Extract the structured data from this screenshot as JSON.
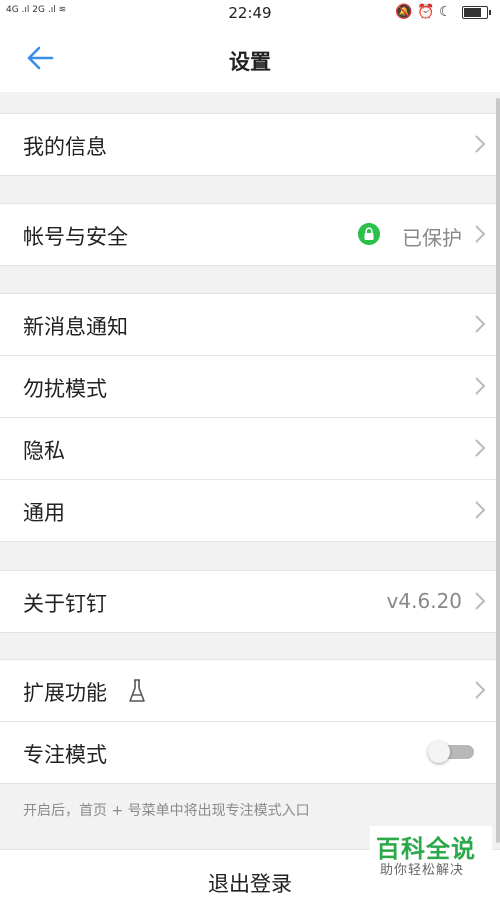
{
  "status_bar": {
    "signal": "4G .ıl 2G .ıl ≋",
    "time": "22:49",
    "right_icons": "🔕 ⏰ ☾"
  },
  "header": {
    "title": "设置"
  },
  "groups": {
    "profile": {
      "label": "我的信息"
    },
    "account": {
      "label": "帐号与安全",
      "status": "已保护"
    },
    "notifications": {
      "label": "新消息通知"
    },
    "dnd": {
      "label": "勿扰模式"
    },
    "privacy": {
      "label": "隐私"
    },
    "general": {
      "label": "通用"
    },
    "about": {
      "label": "关于钉钉",
      "version": "v4.6.20"
    },
    "extensions": {
      "label": "扩展功能"
    },
    "focus": {
      "label": "专注模式",
      "enabled": false
    }
  },
  "focus_hint": "开启后，首页 + 号菜单中将出现专注模式入口",
  "logout_label": "退出登录",
  "watermark": {
    "title": "百科全说",
    "subtitle": "助你轻松解决"
  },
  "colors": {
    "accent_blue": "#3b8ee6",
    "lock_green": "#2ac14a",
    "background": "#f2f2f2"
  },
  "icons": [
    "back-arrow-icon",
    "chevron-right-icon",
    "lock-icon",
    "flask-icon"
  ]
}
